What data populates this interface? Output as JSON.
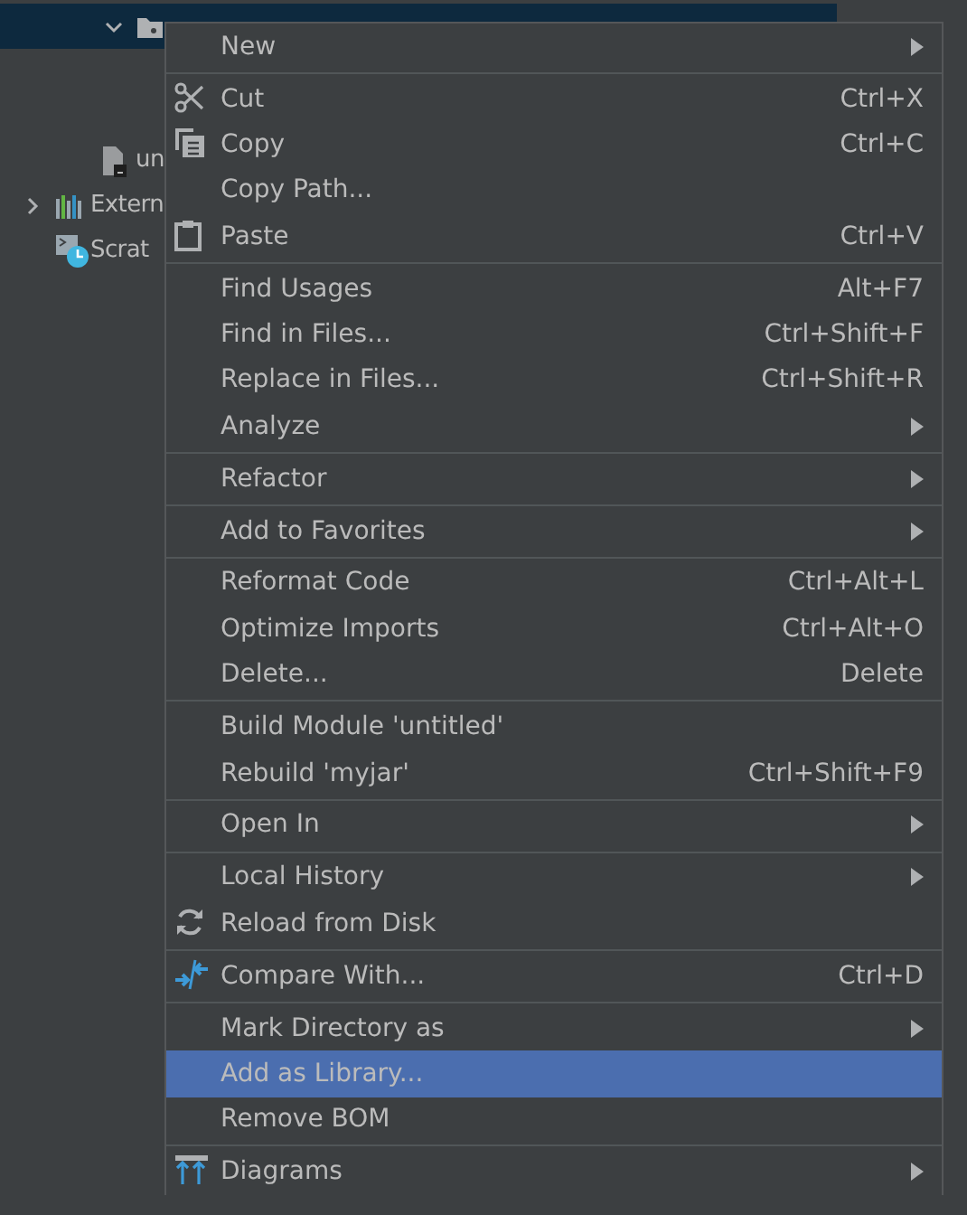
{
  "project_tree": {
    "items": [
      {
        "kind": "folder",
        "expanded": true,
        "selected": true
      },
      {
        "kind": "file",
        "label": "un",
        "selected": false
      },
      {
        "kind": "library",
        "label": "Extern",
        "expanded": false,
        "selected": false
      },
      {
        "kind": "scratch",
        "label": "Scrat",
        "selected": false
      }
    ]
  },
  "context_menu": {
    "groups": [
      [
        {
          "label": "New",
          "submenu": true,
          "selected": false
        }
      ],
      [
        {
          "label": "Cut",
          "shortcut": "Ctrl+X",
          "kind": "scissors",
          "selected": false
        },
        {
          "label": "Copy",
          "shortcut": "Ctrl+C",
          "kind": "copy",
          "selected": false
        },
        {
          "label": "Copy Path...",
          "selected": false
        },
        {
          "label": "Paste",
          "shortcut": "Ctrl+V",
          "kind": "clipboard",
          "selected": false
        }
      ],
      [
        {
          "label": "Find Usages",
          "shortcut": "Alt+F7",
          "selected": false
        },
        {
          "label": "Find in Files...",
          "shortcut": "Ctrl+Shift+F",
          "selected": false
        },
        {
          "label": "Replace in Files...",
          "shortcut": "Ctrl+Shift+R",
          "selected": false
        },
        {
          "label": "Analyze",
          "submenu": true,
          "selected": false
        }
      ],
      [
        {
          "label": "Refactor",
          "submenu": true,
          "selected": false
        }
      ],
      [
        {
          "label": "Add to Favorites",
          "submenu": true,
          "selected": false
        }
      ],
      [
        {
          "label": "Reformat Code",
          "shortcut": "Ctrl+Alt+L",
          "selected": false
        },
        {
          "label": "Optimize Imports",
          "shortcut": "Ctrl+Alt+O",
          "selected": false
        },
        {
          "label": "Delete...",
          "shortcut": "Delete",
          "selected": false
        }
      ],
      [
        {
          "label": "Build Module 'untitled'",
          "selected": false
        },
        {
          "label": "Rebuild 'myjar'",
          "shortcut": "Ctrl+Shift+F9",
          "selected": false
        }
      ],
      [
        {
          "label": "Open In",
          "submenu": true,
          "selected": false
        }
      ],
      [
        {
          "label": "Local History",
          "submenu": true,
          "selected": false
        },
        {
          "label": "Reload from Disk",
          "kind": "reload",
          "selected": false
        }
      ],
      [
        {
          "label": "Compare With...",
          "shortcut": "Ctrl+D",
          "kind": "compare",
          "selected": false
        }
      ],
      [
        {
          "label": "Mark Directory as",
          "submenu": true,
          "selected": false
        },
        {
          "label": "Add as Library...",
          "selected": true
        },
        {
          "label": "Remove BOM",
          "selected": false
        }
      ],
      [
        {
          "label": "Diagrams",
          "submenu": true,
          "kind": "diagram",
          "selected": false
        }
      ]
    ]
  }
}
